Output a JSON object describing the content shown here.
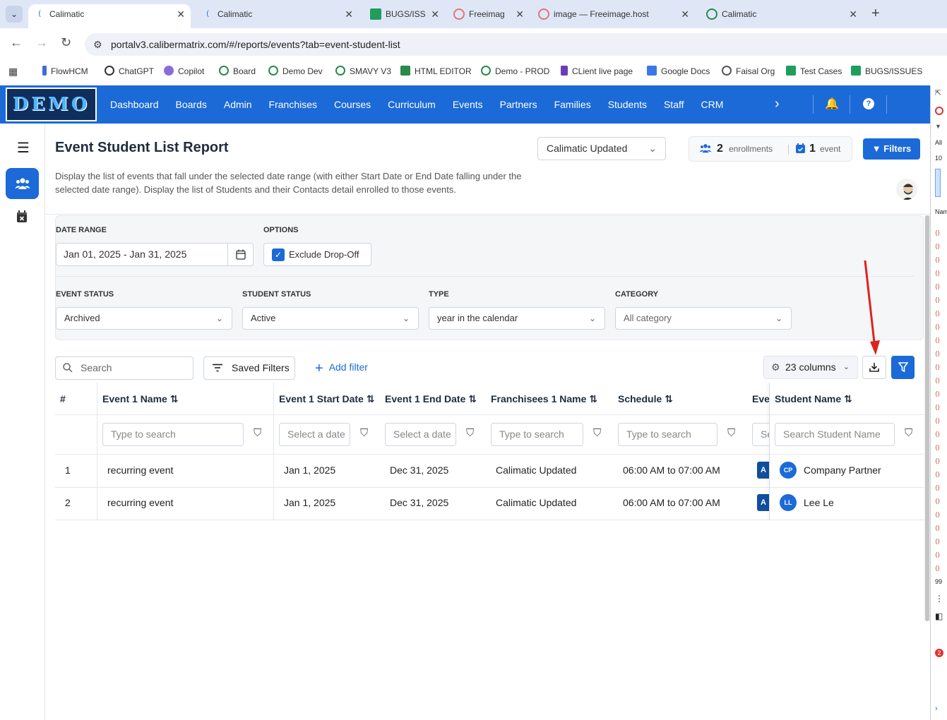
{
  "browser": {
    "tabs": [
      {
        "title": "Calimatic",
        "active": true
      },
      {
        "title": "Calimatic",
        "active": false
      },
      {
        "title": "BUGS/ISS",
        "active": false
      },
      {
        "title": "Freeimag",
        "active": false
      },
      {
        "title": "image — Freeimage.host",
        "active": false
      },
      {
        "title": "Calimatic",
        "active": false
      }
    ],
    "url": "portalv3.calibermatrix.com/#/reports/events?tab=event-student-list",
    "bookmarks": [
      "FlowHCM",
      "ChatGPT",
      "Copilot",
      "Board",
      "Demo Dev",
      "SMAVY V3",
      "HTML EDITOR",
      "Demo - PROD",
      "CLient live page",
      "Google Docs",
      "Faisal Org",
      "Test Cases",
      "BUGS/ISSUES"
    ]
  },
  "app": {
    "logo_text": "DEMO",
    "menu": [
      "Dashboard",
      "Boards",
      "Admin",
      "Franchises",
      "Courses",
      "Curriculum",
      "Events",
      "Partners",
      "Families",
      "Students",
      "Staff",
      "CRM"
    ],
    "brand_color": "#1b6ad8"
  },
  "page": {
    "title": "Event Student List Report",
    "description": "Display the list of events that fall under the selected date range (with either Start Date or End Date falling under the selected date range). Display the list of Students and their Contacts detail enrolled to those events.",
    "franchise": "Calimatic Updated",
    "enrollments_count": "2",
    "enrollments_label": "enrollments",
    "events_count": "1",
    "events_label": "event",
    "filters_button": "Filters"
  },
  "filters": {
    "date_range_label": "DATE RANGE",
    "date_range_value": "Jan 01, 2025 - Jan 31, 2025",
    "options_label": "OPTIONS",
    "exclude_dropoff_label": "Exclude Drop-Off",
    "exclude_dropoff_checked": true,
    "event_status_label": "EVENT STATUS",
    "event_status_value": "Archived",
    "student_status_label": "STUDENT STATUS",
    "student_status_value": "Active",
    "type_label": "TYPE",
    "type_value": "year in the calendar",
    "category_label": "CATEGORY",
    "category_value": "All category"
  },
  "toolbar": {
    "search_placeholder": "Search",
    "saved_filters": "Saved Filters",
    "add_filter": "Add filter",
    "columns": "23 columns"
  },
  "table": {
    "headers": {
      "num": "#",
      "event_name": "Event 1 Name",
      "start_date": "Event 1 Start Date",
      "end_date": "Event 1 End Date",
      "franchisee": "Franchisees 1 Name",
      "schedule": "Schedule",
      "truncated": "Eve",
      "student_name": "Student Name"
    },
    "filter_placeholders": {
      "event_name": "Type to search",
      "start_date": "Select a date",
      "end_date": "Select a date",
      "franchisee": "Type to search",
      "schedule": "Type to search",
      "truncated": "Se",
      "student_name": "Search Student Name"
    },
    "rows": [
      {
        "num": "1",
        "event_name": "recurring event",
        "start_date": "Jan 1, 2025",
        "end_date": "Dec 31, 2025",
        "franchisee": "Calimatic Updated",
        "schedule": "06:00 AM to 07:00 AM",
        "truncated": "A",
        "student_initials": "CP",
        "student_name": "Company Partner"
      },
      {
        "num": "2",
        "event_name": "recurring event",
        "start_date": "Jan 1, 2025",
        "end_date": "Dec 31, 2025",
        "franchisee": "Calimatic Updated",
        "schedule": "06:00 AM to 07:00 AM",
        "truncated": "A",
        "student_initials": "LL",
        "student_name": "Lee Le"
      }
    ]
  },
  "devtools": {
    "numbers": [
      "10",
      "99",
      "2"
    ],
    "label": "Nam",
    "filter_value": "All"
  }
}
